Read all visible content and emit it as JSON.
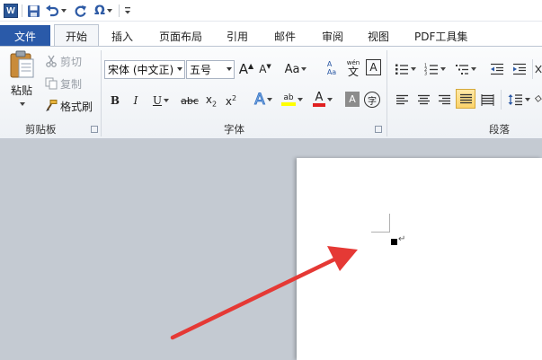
{
  "app": {
    "logo_letter": "W"
  },
  "tabs": {
    "file": "文件",
    "items": [
      "开始",
      "插入",
      "页面布局",
      "引用",
      "邮件",
      "审阅",
      "视图",
      "PDF工具集"
    ]
  },
  "clipboard": {
    "paste": "粘贴",
    "cut": "剪切",
    "copy": "复制",
    "format_painter": "格式刷",
    "group_label": "剪贴板"
  },
  "font": {
    "font_name": "宋体 (中文正)",
    "font_size": "五号",
    "group_label": "字体"
  },
  "paragraph": {
    "group_label": "段落"
  },
  "colors": {
    "file_tab": "#2a5aa9",
    "font_color": "#e02020",
    "highlight": "#ffff00",
    "arrow": "#e53935"
  }
}
